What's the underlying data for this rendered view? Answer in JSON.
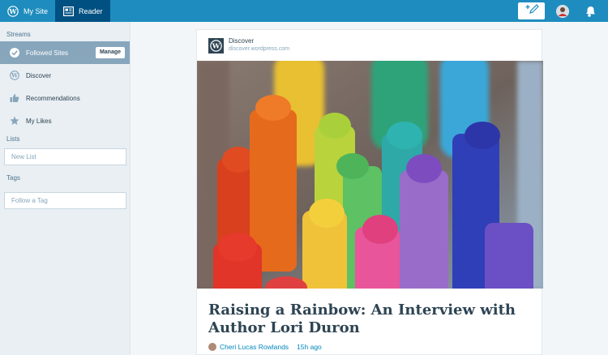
{
  "topbar": {
    "my_site_label": "My Site",
    "reader_label": "Reader",
    "accent": "#1e8cbe",
    "active_tab_bg": "#005082"
  },
  "sidebar": {
    "streams_heading": "Streams",
    "items": [
      {
        "label": "Followed Sites",
        "icon": "checkmark-icon",
        "selected": true
      },
      {
        "label": "Discover",
        "icon": "wordpress-icon"
      },
      {
        "label": "Recommendations",
        "icon": "thumbs-up-icon"
      },
      {
        "label": "My Likes",
        "icon": "star-icon"
      }
    ],
    "manage_label": "Manage",
    "lists_heading": "Lists",
    "new_list_placeholder": "New List",
    "tags_heading": "Tags",
    "follow_tag_placeholder": "Follow a Tag"
  },
  "post": {
    "site_name": "Discover",
    "site_url": "discover.wordpress.com",
    "title": "Raising a Rainbow: An Interview with Author Lori Duron",
    "author": "Cheri Lucas Rowlands",
    "time_ago": "15h ago"
  }
}
